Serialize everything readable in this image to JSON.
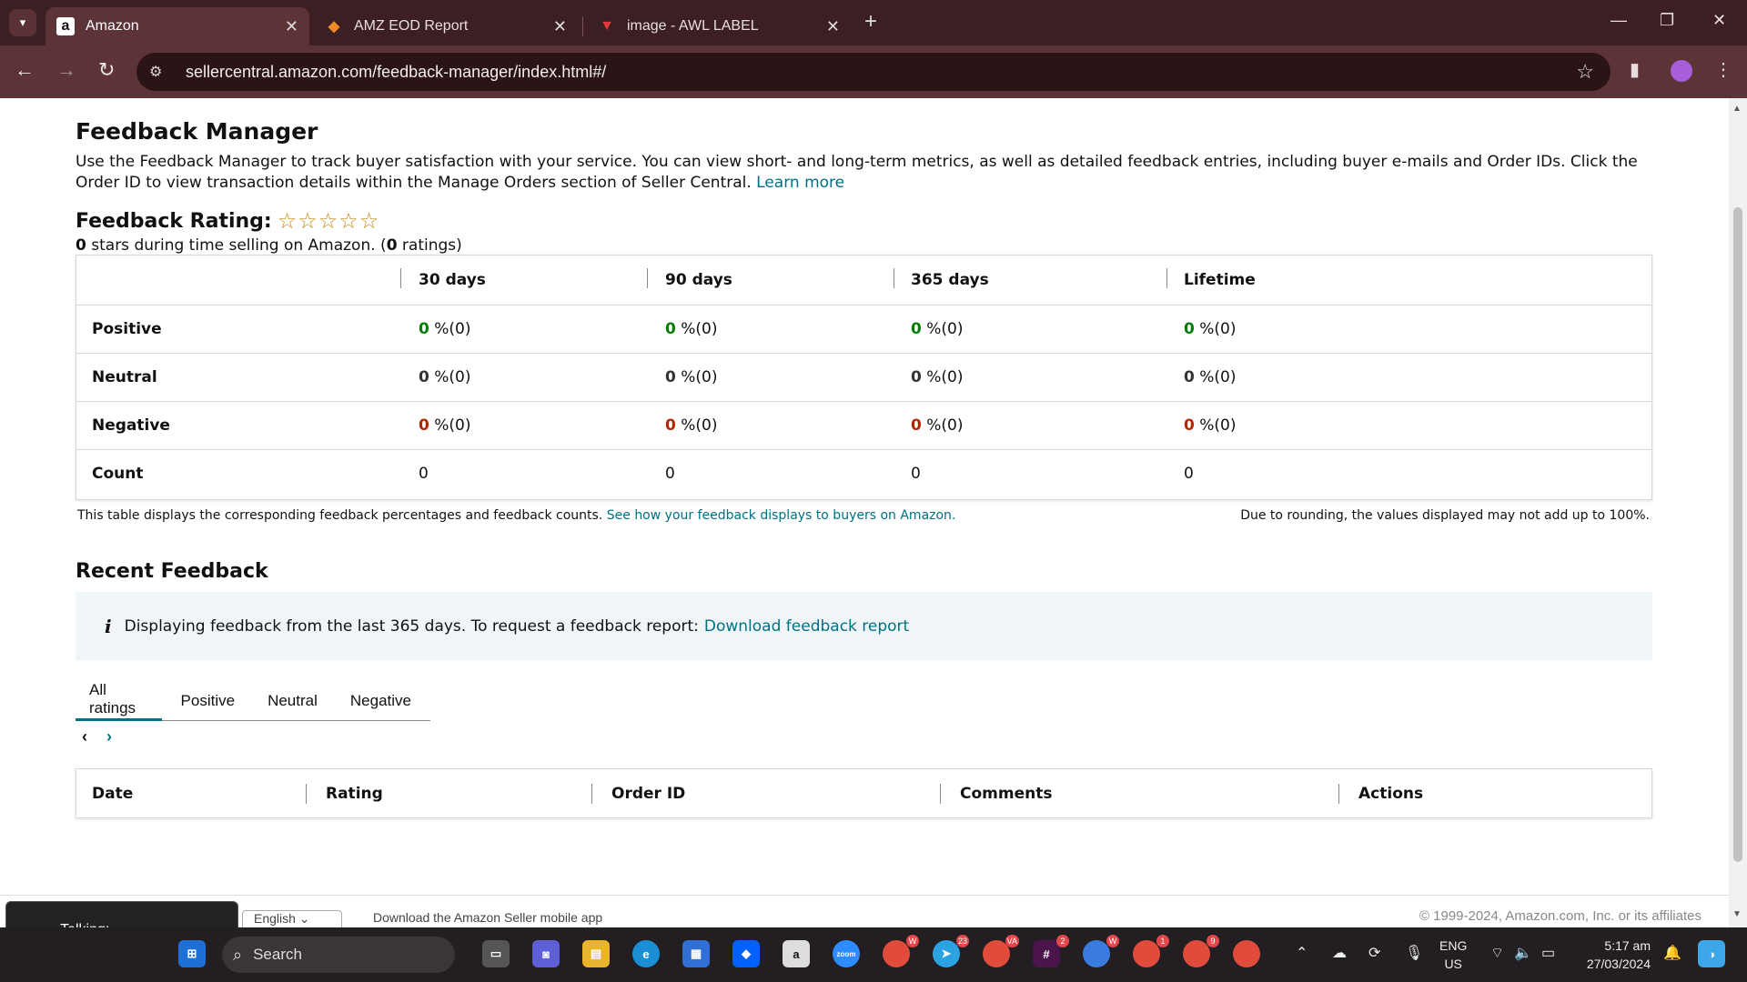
{
  "browser": {
    "tabs": [
      {
        "title": "Amazon",
        "favicon": "a"
      },
      {
        "title": "AMZ EOD Report",
        "favicon": "◆"
      },
      {
        "title": "image - AWL LABEL",
        "favicon": "▼"
      }
    ],
    "url": "sellercentral.amazon.com/feedback-manager/index.html#/"
  },
  "feedback_manager": {
    "title": "Feedback Manager",
    "description": "Use the Feedback Manager to track buyer satisfaction with your service. You can view short- and long-term metrics, as well as detailed feedback entries, including buyer e-mails and Order IDs. Click the Order ID to view transaction details within the Manage Orders section of Seller Central.",
    "learn_more": "Learn more",
    "rating_title": "Feedback Rating:",
    "stars": "☆☆☆☆☆",
    "rating_count_value": "0",
    "rating_sub_mid": " stars during time selling on Amazon. (",
    "rating_ratings_value": "0",
    "rating_sub_end": " ratings)"
  },
  "metrics_table": {
    "columns": [
      "30 days",
      "90 days",
      "365 days",
      "Lifetime"
    ],
    "rows": [
      {
        "label": "Positive",
        "values": [
          "0",
          "0",
          "0",
          "0"
        ],
        "suffix": " %(0)"
      },
      {
        "label": "Neutral",
        "values": [
          "0",
          "0",
          "0",
          "0"
        ],
        "suffix": " %(0)"
      },
      {
        "label": "Negative",
        "values": [
          "0",
          "0",
          "0",
          "0"
        ],
        "suffix": " %(0)"
      },
      {
        "label": "Count",
        "values": [
          "0",
          "0",
          "0",
          "0"
        ],
        "suffix": ""
      }
    ],
    "note_left": "This table displays the corresponding feedback percentages and feedback counts.",
    "note_left_link": "See how your feedback displays to buyers on Amazon.",
    "note_right": "Due to rounding, the values displayed may not add up to 100%."
  },
  "recent_feedback": {
    "title": "Recent Feedback",
    "info_text": "Displaying feedback from the last 365 days. To request a feedback report:",
    "info_link": "Download feedback report",
    "tabs": [
      "All ratings",
      "Positive",
      "Neutral",
      "Negative"
    ],
    "pager_prev": "‹",
    "pager_next": "›",
    "columns": [
      "Date",
      "Rating",
      "Order ID",
      "Comments",
      "Actions"
    ]
  },
  "footer": {
    "language": "English",
    "app_text": "Download the Amazon Seller mobile app",
    "copyright": "© 1999-2024, Amazon.com, Inc. or its affiliates"
  },
  "talking": {
    "label": "Talking:"
  },
  "taskbar": {
    "search": "Search",
    "lang_top": "ENG",
    "lang_bottom": "US",
    "time": "5:17 am",
    "date": "27/03/2024",
    "badges": {
      "chrome1": "W",
      "telegram": "23",
      "chrome2": "VA",
      "slack": "2",
      "chrome3": "W",
      "chrome4": "1",
      "chrome5": "9"
    }
  },
  "colors": {
    "positive": "#067d06",
    "negative": "#b12704",
    "link": "#007185",
    "browser_frame": "#3b1f22"
  }
}
